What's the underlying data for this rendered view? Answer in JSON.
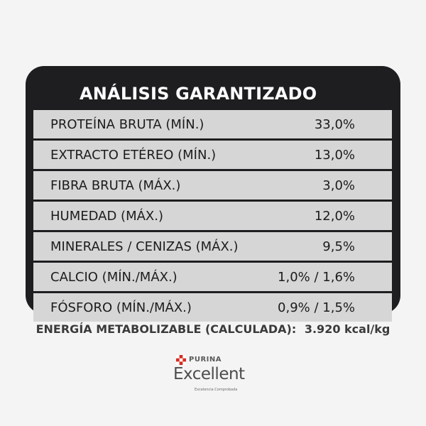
{
  "table": {
    "title": "ANÁLISIS GARANTIZADO",
    "rows": [
      {
        "label": "PROTEÍNA BRUTA (MÍN.)",
        "value": "33,0%"
      },
      {
        "label": "EXTRACTO ETÉREO (MÍN.)",
        "value": "13,0%"
      },
      {
        "label": "FIBRA BRUTA (MÁX.)",
        "value": "3,0%"
      },
      {
        "label": "HUMEDAD (MÁX.)",
        "value": "12,0%"
      },
      {
        "label": "MINERALES / CENIZAS (MÁX.)",
        "value": "9,5%"
      },
      {
        "label": "CALCIO (MÍN./MÁX.)",
        "value": "1,0% / 1,6%"
      },
      {
        "label": "FÓSFORO (MÍN./MÁX.)",
        "value": "0,9% / 1,5%"
      }
    ]
  },
  "energy": {
    "label": "ENERGÍA METABOLIZABLE (CALCULADA):",
    "value": "3.920 kcal/kg"
  },
  "logo": {
    "brand": "PURINA",
    "product": "Excellent",
    "tagline": "Excelencia Comprobada"
  },
  "colors": {
    "background": "#f4f4f4",
    "panel": "#1e1e20",
    "row": "#d6d6d6",
    "purina_red": "#d52b1e"
  }
}
